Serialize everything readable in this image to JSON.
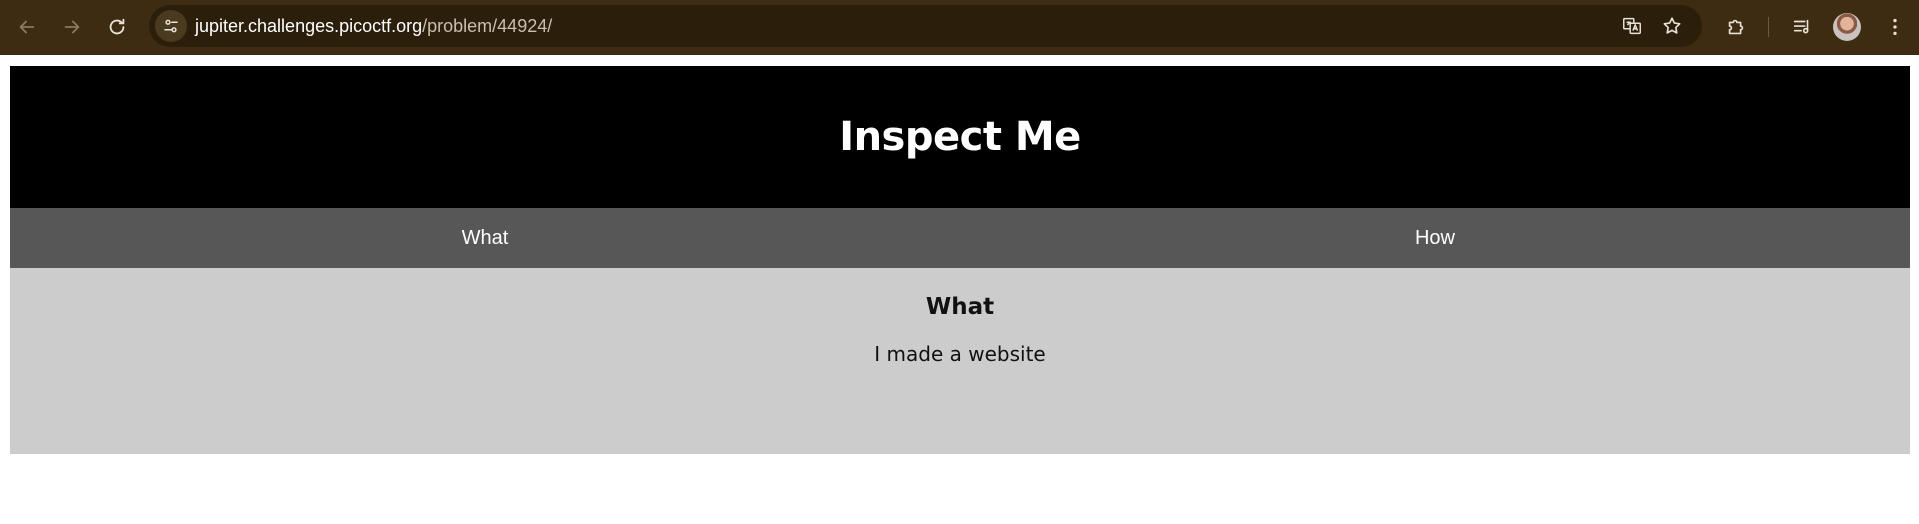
{
  "browser": {
    "url_host": "jupiter.challenges.picoctf.org",
    "url_path": "/problem/44924/",
    "chrome_color": "#3d2c12"
  },
  "page": {
    "title": "Inspect Me",
    "tabs": [
      {
        "label": "What"
      },
      {
        "label": "How"
      }
    ],
    "section": {
      "heading": "What",
      "text": "I made a website"
    },
    "colors": {
      "header_bg": "#000000",
      "tabs_bg": "#575757",
      "content_bg": "#cccccc"
    }
  }
}
